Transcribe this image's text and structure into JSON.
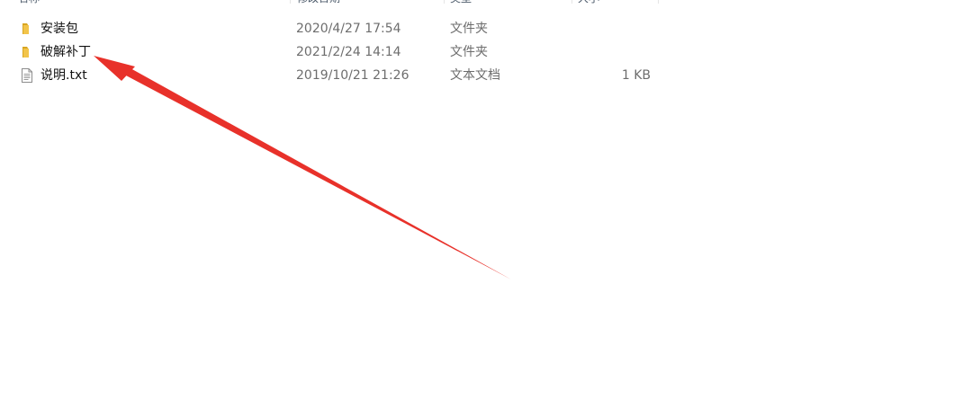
{
  "columns": {
    "name": "名称",
    "date_modified": "修改日期",
    "type": "类型",
    "size": "大小"
  },
  "files": [
    {
      "name": "安装包",
      "date_modified": "2020/4/27 17:54",
      "type": "文件夹",
      "size": "",
      "icon": "folder-icon"
    },
    {
      "name": "破解补丁",
      "date_modified": "2021/2/24 14:14",
      "type": "文件夹",
      "size": "",
      "icon": "folder-icon"
    },
    {
      "name": "说明.txt",
      "date_modified": "2019/10/21 21:26",
      "type": "文本文档",
      "size": "1 KB",
      "icon": "text-file-icon"
    }
  ],
  "annotation": {
    "icon": "red-arrow-icon",
    "color": "#e8312a",
    "points_to": "破解补丁"
  },
  "colors": {
    "folder": "#f2c44a",
    "folder_dark": "#d9a520",
    "secondary_text": "#6d6d6d"
  }
}
